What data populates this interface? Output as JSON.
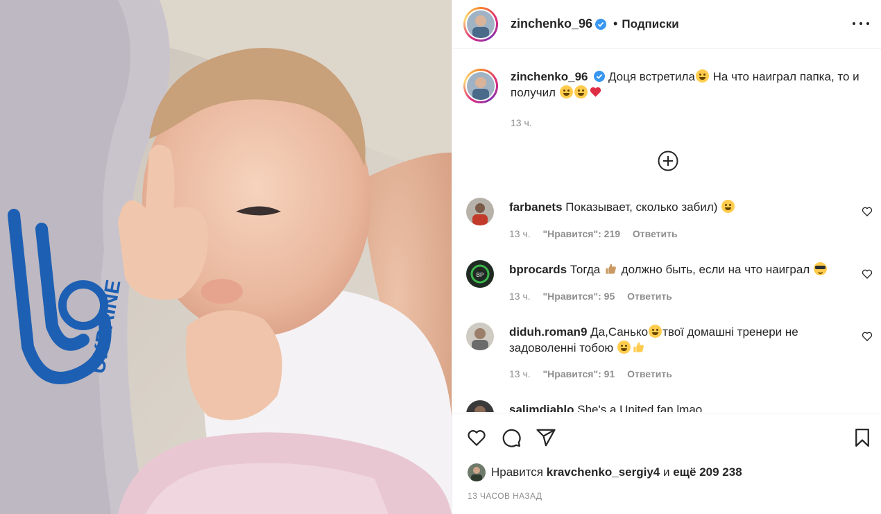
{
  "post": {
    "username": "zinchenko_96",
    "separator": "•",
    "follow_label": "Подписки",
    "photo_alt_text": "UKRAINE"
  },
  "caption": {
    "username": "zinchenko_96",
    "text_part1": "Доця встретила",
    "text_part2": " На что наиграл папка, то и получил ",
    "time": "13 ч."
  },
  "comments": [
    {
      "username": "farbanets",
      "text": "Показывает, сколько забил) ",
      "time": "13 ч.",
      "likes": "\"Нравится\": 219",
      "reply": "Ответить"
    },
    {
      "username": "bprocards",
      "text_part1": "Тогда ",
      "text_part2": " должно быть, если на что наиграл ",
      "time": "13 ч.",
      "likes": "\"Нравится\": 95",
      "reply": "Ответить"
    },
    {
      "username": "diduh.roman9",
      "text_part1": "Да,Санько",
      "text_part2": "твої домашні тренери не задоволенні тобою ",
      "time": "13 ч.",
      "likes": "\"Нравится\": 91",
      "reply": "Ответить"
    },
    {
      "username": "salimdiablo",
      "text": "She's a United fan lmao"
    }
  ],
  "likes_summary": {
    "prefix": "Нравится",
    "user": "kravchenko_sergiy4",
    "middle": "и",
    "rest": "ещё 209 238"
  },
  "post_time": "13 ЧАСОВ НАЗАД",
  "colors": {
    "verified": "#3897f0",
    "heart_red": "#ed4956",
    "meta_gray": "#8e8e8e",
    "jersey_blue": "#1d5fb3"
  }
}
